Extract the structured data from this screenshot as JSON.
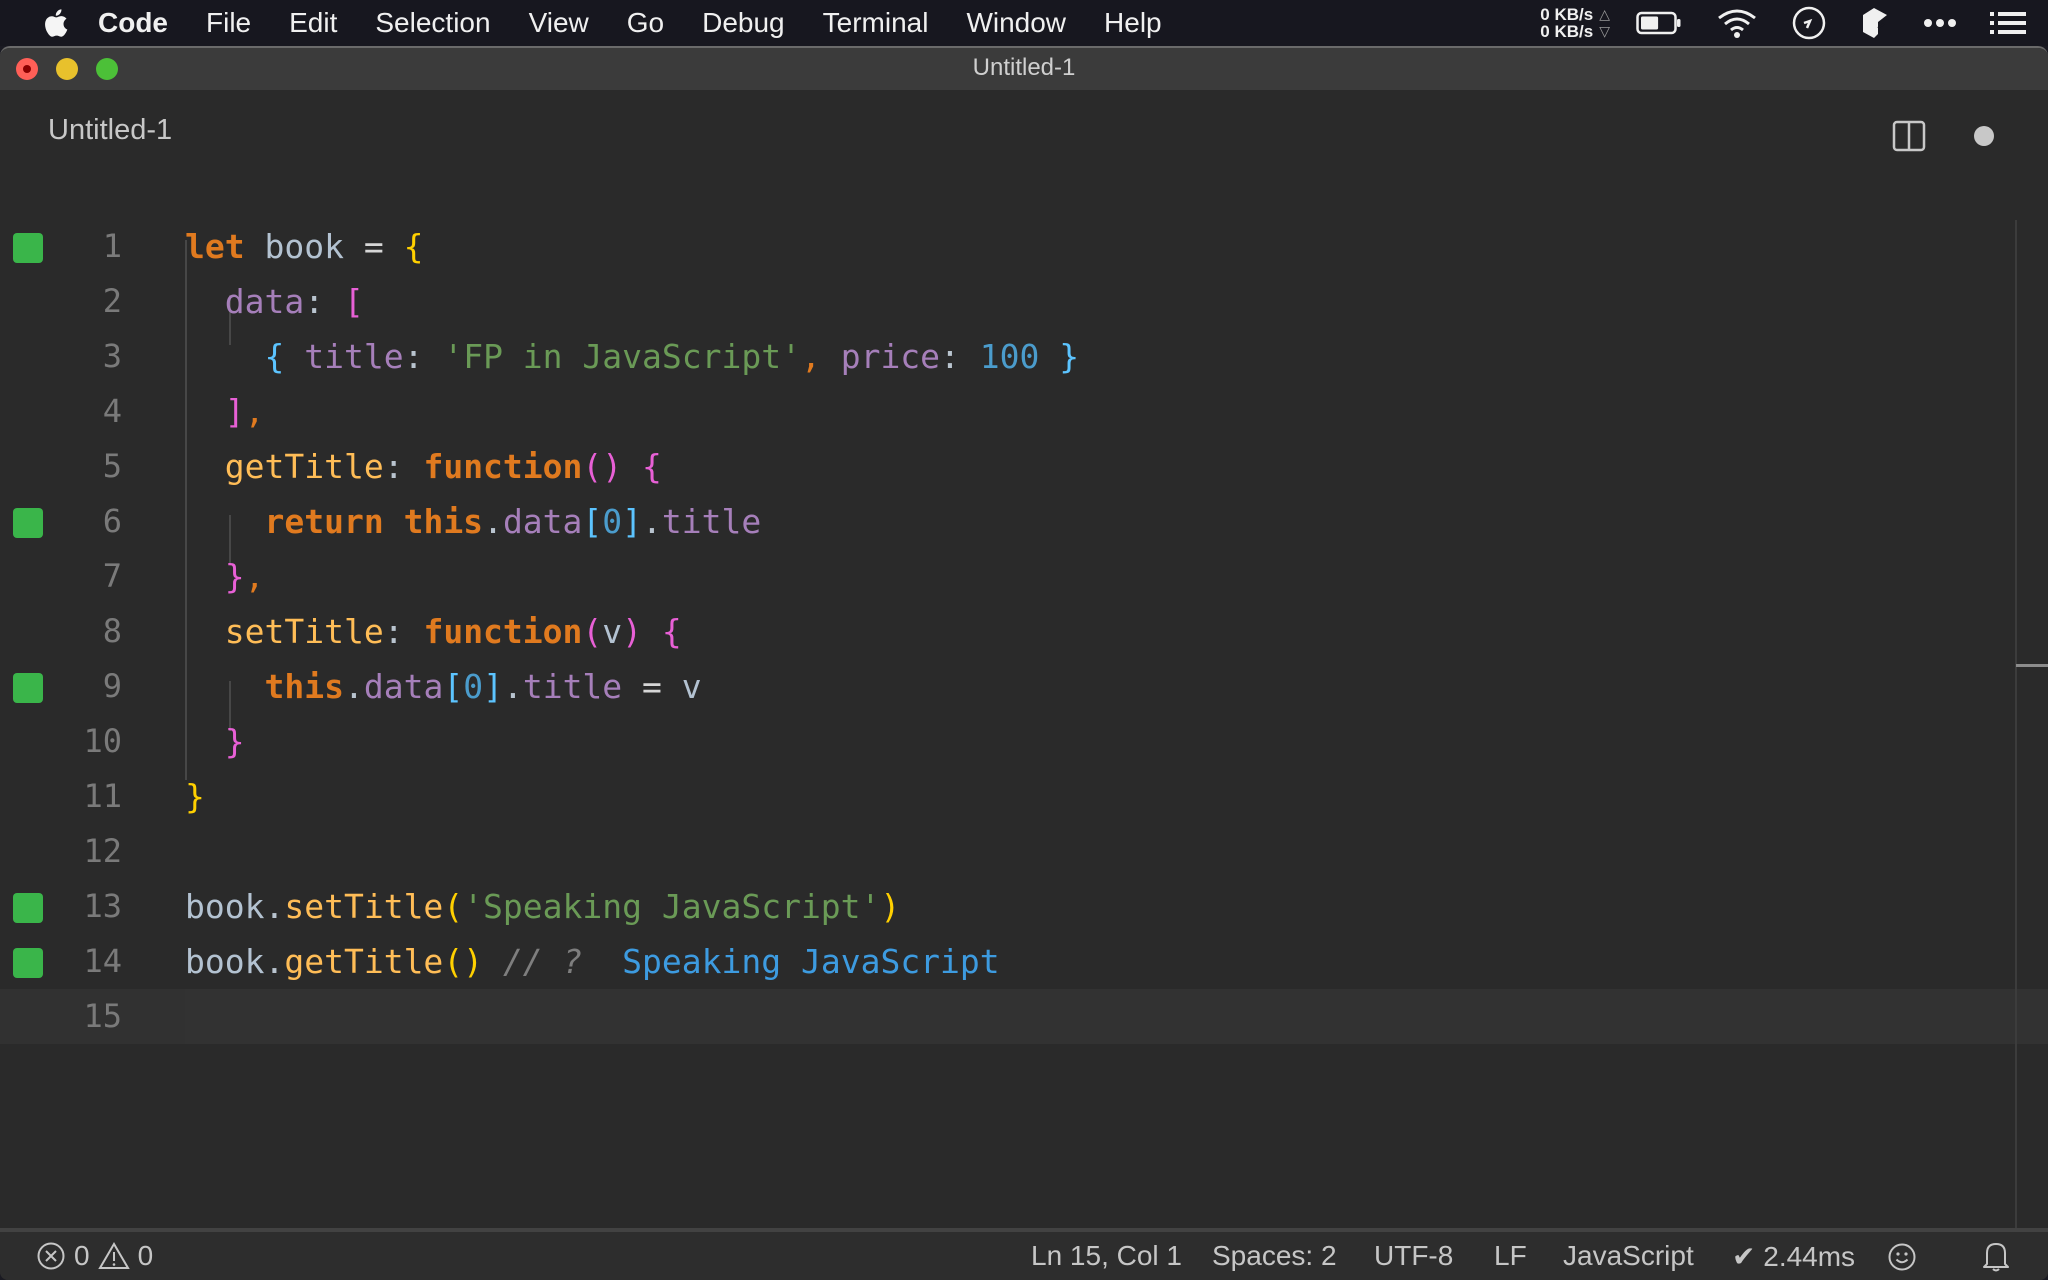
{
  "menubar": {
    "app_name": "Code",
    "items": [
      "File",
      "Edit",
      "Selection",
      "View",
      "Go",
      "Debug",
      "Terminal",
      "Window",
      "Help"
    ],
    "net_up": "0 KB/s",
    "net_down": "0 KB/s",
    "battery_level": 0.55
  },
  "window": {
    "title": "Untitled-1"
  },
  "tab": {
    "label": "Untitled-1",
    "dirty": true
  },
  "editor": {
    "lines": [
      {
        "n": "1",
        "marked": true
      },
      {
        "n": "2",
        "marked": false
      },
      {
        "n": "3",
        "marked": false
      },
      {
        "n": "4",
        "marked": false
      },
      {
        "n": "5",
        "marked": false
      },
      {
        "n": "6",
        "marked": true
      },
      {
        "n": "7",
        "marked": false
      },
      {
        "n": "8",
        "marked": false
      },
      {
        "n": "9",
        "marked": true
      },
      {
        "n": "10",
        "marked": false
      },
      {
        "n": "11",
        "marked": false
      },
      {
        "n": "12",
        "marked": false
      },
      {
        "n": "13",
        "marked": true
      },
      {
        "n": "14",
        "marked": true
      },
      {
        "n": "15",
        "marked": false
      }
    ],
    "tokens": {
      "l1": [
        "let",
        "book",
        "=",
        "{"
      ],
      "l2": [
        "data",
        ":",
        "["
      ],
      "l3": [
        "{",
        "title",
        ":",
        "'FP in JavaScript'",
        ",",
        "price",
        ":",
        "100",
        "}"
      ],
      "l4": [
        "]",
        ","
      ],
      "l5": [
        "getTitle",
        ":",
        "function",
        "()",
        "{"
      ],
      "l6": [
        "return",
        "this",
        ".",
        "data",
        "[",
        "0",
        "]",
        ".",
        "title"
      ],
      "l7": [
        "}",
        ","
      ],
      "l8": [
        "setTitle",
        ":",
        "function",
        "(",
        "v",
        ")",
        "{"
      ],
      "l9": [
        "this",
        ".",
        "data",
        "[",
        "0",
        "]",
        ".",
        "title",
        "=",
        "v"
      ],
      "l10": [
        "}"
      ],
      "l11": [
        "}"
      ],
      "l13": [
        "book",
        ".",
        "setTitle",
        "(",
        "'Speaking JavaScript'",
        ")"
      ],
      "l14": [
        "book",
        ".",
        "getTitle",
        "()",
        "// ?",
        "Speaking JavaScript"
      ]
    },
    "current_line": 15,
    "colors": {
      "gutter_mark": "#3ab54a",
      "keyword": "#e07a1f",
      "string": "#6a9a56",
      "result": "#3d9be0"
    }
  },
  "statusbar": {
    "errors": "0",
    "warnings": "0",
    "position": "Ln 15, Col 1",
    "indent": "Spaces: 2",
    "encoding": "UTF-8",
    "eol": "LF",
    "language": "JavaScript",
    "timing": "✔ 2.44ms"
  }
}
